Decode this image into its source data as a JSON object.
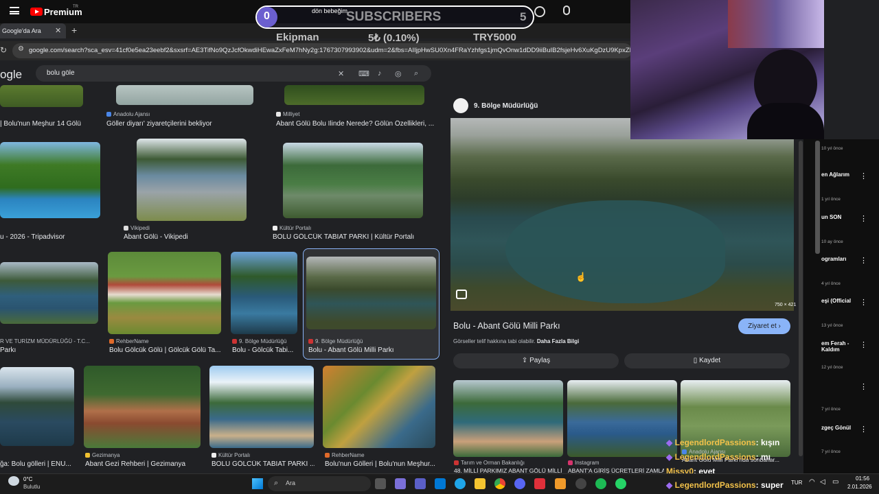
{
  "youtube": {
    "premium": "Premium",
    "region": "TR"
  },
  "browser": {
    "tab_title": "Google'da Ara",
    "url": "google.com/search?sca_esv=41cf0e5ea23eebf2&sxsrf=AE3TifNo9QzJcfOkwdiHEwaZxFeM7hNy2g:1767307993902&udm=2&fbs=AIIjpHwSU0Xn4FRaYzhfgs1jmQvOnw1dDD9iiBuIB2fsjeHv6XuKgDzU9KpxZMcpsjQN"
  },
  "google": {
    "logo": "ogle",
    "query": "bolu göle"
  },
  "results": [
    {
      "src": "",
      "title": "| Bolu'nun Meşhur 14 Gölü"
    },
    {
      "src": "Anadolu Ajansı",
      "title": "Göller diyarı' ziyaretçilerini bekliyor"
    },
    {
      "src": "Milliyet",
      "title": "Abant Gölü Bolu İlinde Nerede? Gölün Özellikleri, ..."
    },
    {
      "src": "",
      "title": "u - 2026 - Tripadvisor"
    },
    {
      "src": "Vikipedi",
      "title": "Abant Gölü - Vikipedi"
    },
    {
      "src": "Kültür Portalı",
      "title": "BOLU GÖLCÜK TABİAT PARKI | Kültür Portalı"
    },
    {
      "src": "R VE TURİZM MÜDÜRLÜĞÜ - T.C...",
      "title": "Parkı"
    },
    {
      "src": "RehberName",
      "title": "Bolu Gölcük Gölü | Gölcük Gölü Ta..."
    },
    {
      "src": "9. Bölge Müdürlüğü",
      "title": "Bolu - Gölcük Tabi..."
    },
    {
      "src": "9. Bölge Müdürlüğü",
      "title": "Bolu - Abant Gölü Milli Parkı"
    },
    {
      "src": "",
      "title": "ğa: Bolu gölleri | ENU..."
    },
    {
      "src": "Gezimanya",
      "title": "Abant Gezi Rehberi | Gezimanya"
    },
    {
      "src": "Kültür Portalı",
      "title": "BOLU GÖLCÜK TABİAT PARKI ..."
    },
    {
      "src": "RehberName",
      "title": "Bolu'nun Gölleri | Bolu'nun Meşhur..."
    }
  ],
  "panel": {
    "source": "9. Bölge Müdürlüğü",
    "dimensions": "750 × 421",
    "title": "Bolu - Abant Gölü Milli Parkı",
    "visit": "Ziyaret et",
    "copyright": "Görseller telif hakkına tabi olabilir.",
    "more_info": "Daha Fazla Bilgi",
    "share": "Paylaş",
    "save": "Kaydet",
    "related": [
      {
        "src": "Tarım ve Orman Bakanlığı",
        "title": "48. MİLLİ PARKIMIZ ABANT GÖLÜ MİLLİ ..."
      },
      {
        "src": "Instagram",
        "title": "ABANT'A GİRİŞ ÜCRETLERİ ZAMLANDI"
      },
      {
        "src": "Anadolu Ajansı",
        "title": "Abant Gölü Milli Parkı'nda sonbahar..."
      }
    ]
  },
  "overlay": {
    "subscriber_count": "0",
    "subscribers": "SUBSCRIBERS",
    "goal": "5",
    "song": "dön bebeğim",
    "stat1": "Ekipman",
    "stat2": "5₺ (0.10%)",
    "stat3": "TRY5000"
  },
  "yt_sidebar": [
    {
      "title": "",
      "age": "10 yıl önce"
    },
    {
      "title": "en Ağlarım",
      "age": "1 yıl önce"
    },
    {
      "title": "un SON",
      "age": "10 ay önce"
    },
    {
      "title": "ogramları",
      "age": "4 yıl önce"
    },
    {
      "title": "eşi (Official",
      "age": "13 yıl önce"
    },
    {
      "title": "em Ferah - Kaldım",
      "age": "12 yıl önce"
    },
    {
      "title": "",
      "age": "7 yıl önce"
    },
    {
      "title": "zgeç Gönül",
      "age": "7 yıl önce"
    }
  ],
  "chat": [
    {
      "name": "LegendlordPassions",
      "msg": ": kışın"
    },
    {
      "name": "LegendlordPassions",
      "msg": ": mı"
    },
    {
      "name": "Missy0",
      "msg": ": evet"
    },
    {
      "name": "LegendlordPassions",
      "msg": ": super"
    }
  ],
  "taskbar": {
    "temp": "0°C",
    "weather": "Bulutlu",
    "search": "Ara",
    "lang": "TUR",
    "time": "01:56",
    "date": "2.01.2026"
  }
}
